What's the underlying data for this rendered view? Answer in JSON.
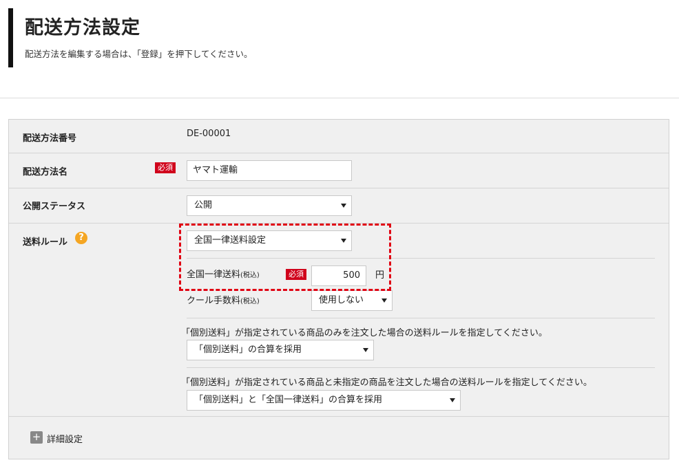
{
  "header": {
    "title": "配送方法設定",
    "description": "配送方法を編集する場合は、「登録」を押下してください。"
  },
  "fields": {
    "delivery_number": {
      "label": "配送方法番号",
      "value": "DE-00001"
    },
    "delivery_name": {
      "label": "配送方法名",
      "required": "必須",
      "value": "ヤマト運輸"
    },
    "status": {
      "label": "公開ステータス",
      "value": "公開"
    },
    "fee_rule": {
      "label": "送料ルール",
      "help": "?",
      "value": "全国一律送料設定",
      "flat_fee": {
        "label": "全国一律送料",
        "label_small": "(税込)",
        "required": "必須",
        "value": "500",
        "unit": "円"
      },
      "cool_fee": {
        "label": "クール手数料",
        "label_small": "(税込)",
        "value": "使用しない"
      },
      "individual_only": {
        "note": "「個別送料」が指定されている商品のみを注文した場合の送料ルールを指定してください。",
        "value": "「個別送料」の合算を採用"
      },
      "individual_mixed": {
        "note": "「個別送料」が指定されている商品と未指定の商品を注文した場合の送料ルールを指定してください。",
        "value": "「個別送料」と「全国一律送料」の合算を採用"
      }
    }
  },
  "detail_settings": {
    "icon": "+",
    "label": "詳細設定"
  },
  "colors": {
    "required_badge": "#d0021b",
    "help_icon": "#f5a623",
    "highlight_border": "#e00012"
  }
}
